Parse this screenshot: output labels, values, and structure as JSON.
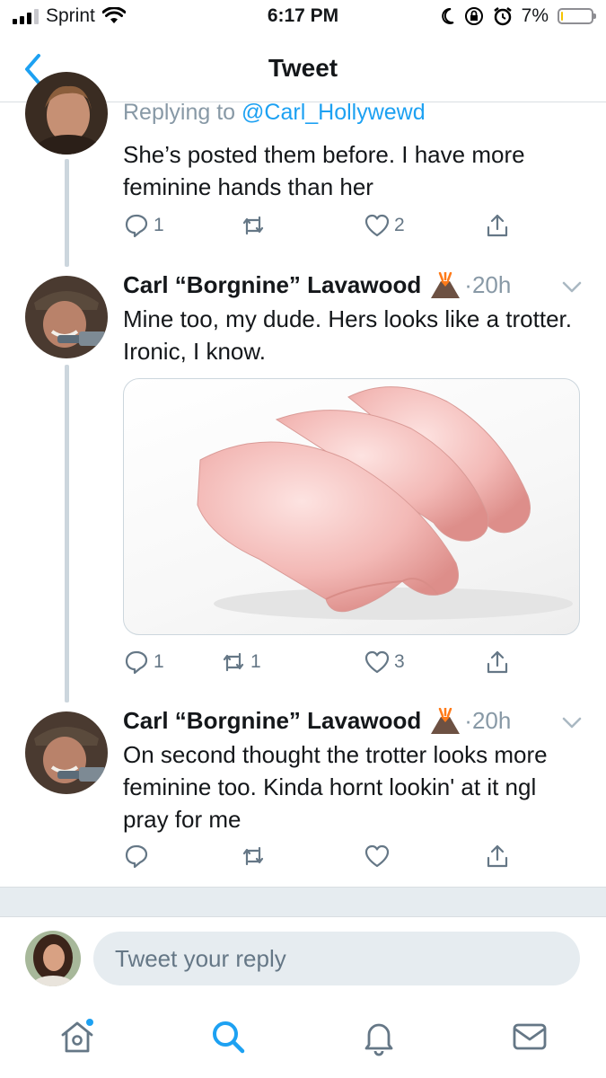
{
  "status_bar": {
    "carrier": "Sprint",
    "time": "6:17 PM",
    "battery": "7%",
    "battery_level": 0.07,
    "icons": [
      "signal-icon",
      "wifi-icon",
      "moon-icon",
      "orientation-lock-icon",
      "alarm-icon",
      "battery-icon"
    ]
  },
  "nav": {
    "title": "Tweet",
    "back_icon": "chevron-left-icon"
  },
  "tweets": [
    {
      "reply_prefix": "Replying to ",
      "reply_handle": "@Carl_Hollywewd",
      "text": "She’s posted them before. I have more feminine hands than her",
      "actions": {
        "reply_count": "1",
        "retweet_count": "",
        "like_count": "2"
      }
    },
    {
      "name": "Carl “Borgnine” Lavawood",
      "separator": "·",
      "time": "20h",
      "text": "Mine too, my dude. Hers looks like a trotter. Ironic, I know.",
      "actions": {
        "reply_count": "1",
        "retweet_count": "1",
        "like_count": "3"
      }
    },
    {
      "name": "Carl “Borgnine” Lavawood",
      "separator": "·",
      "time": "20h",
      "text": "On second thought the trotter looks more feminine too. Kinda hornt lookin' at it ngl pray for me",
      "actions": {
        "reply_count": "",
        "retweet_count": "",
        "like_count": ""
      }
    }
  ],
  "composer": {
    "placeholder": "Tweet your reply",
    "value": ""
  },
  "tabbar": {
    "items": [
      "home-icon",
      "search-icon",
      "notifications-icon",
      "messages-icon"
    ]
  },
  "colors": {
    "accent": "#1da1f2",
    "secondary_text": "#657786",
    "thread_line": "#ccd6dd",
    "battery_low": "#f5c400"
  }
}
